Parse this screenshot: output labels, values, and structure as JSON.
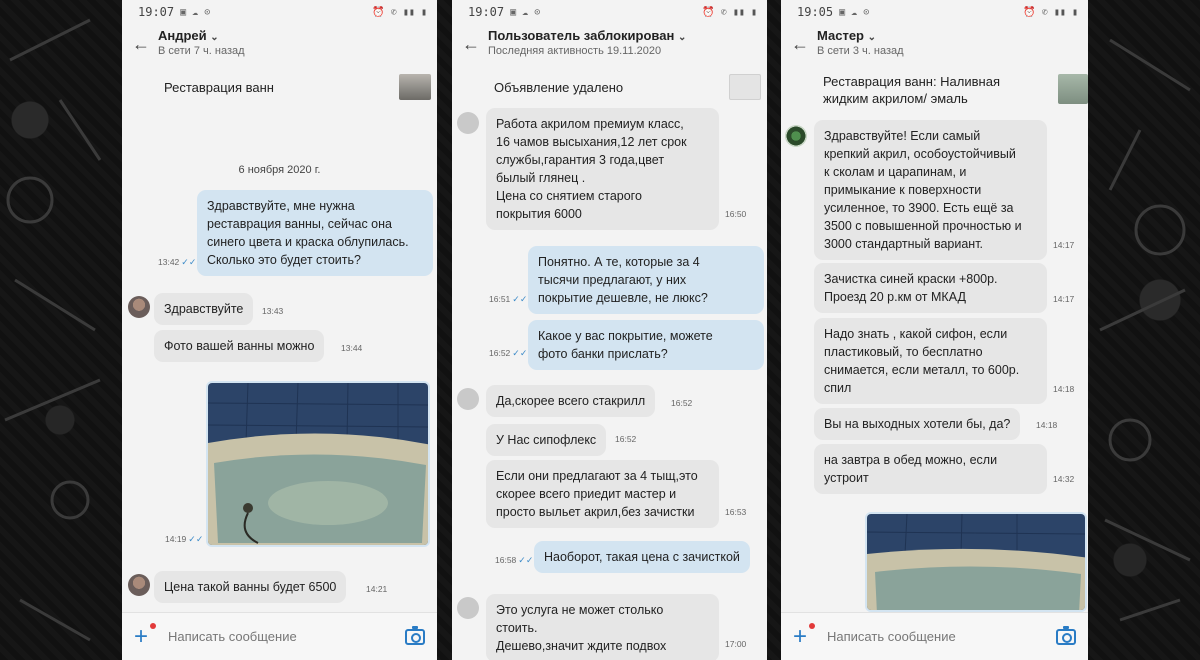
{
  "screens": [
    {
      "status_time": "19:07",
      "contact_name": "Андрей",
      "contact_status": "В сети 7 ч. назад",
      "ad_title": "Реставрация ванн",
      "date_separator": "6 ноября 2020 г.",
      "messages": [
        {
          "dir": "out",
          "text": "Здравствуйте,  мне нужна\nреставрация ванны, сейчас она\nсинего цвета и краска облупилась.\nСколько это будет стоить?",
          "time": "13:42"
        },
        {
          "dir": "in",
          "text": "Здравствуйте",
          "time": "13:43"
        },
        {
          "dir": "in",
          "text": "Фото вашей ванны можно",
          "time": "13:44"
        },
        {
          "dir": "out",
          "text": "",
          "time": "14:19",
          "photo": true
        },
        {
          "dir": "in",
          "text": "Цена такой ванны будет 6500",
          "time": "14:21"
        }
      ],
      "composer_placeholder": "Написать сообщение"
    },
    {
      "status_time": "19:07",
      "contact_name": "Пользователь заблокирован",
      "contact_status": "Последняя активность 19.11.2020",
      "ad_title": "Объявление удалено",
      "messages": [
        {
          "dir": "in",
          "text": "Работа акрилом премиум класс,\n16 чамов высыхания,12 лет срок\nслужбы,гарантия 3 года,цвет\nбылый глянец .\nЦена со снятием старого\nпокрытия 6000",
          "time": "16:50"
        },
        {
          "dir": "out",
          "text": "Понятно. А те, которые за 4\nтысячи предлагают, у них\nпокрытие дешевле, не люкс?",
          "time": "16:51"
        },
        {
          "dir": "out",
          "text": "Какое у вас покрытие, можете\nфото банки прислать?",
          "time": "16:52"
        },
        {
          "dir": "in",
          "text": "Да,скорее всего стакрилл",
          "time": "16:52"
        },
        {
          "dir": "in",
          "text": "У Нас сипофлекс",
          "time": "16:52"
        },
        {
          "dir": "in",
          "text": "Если они предлагают за 4 тыщ,это\nскорее всего приедит мастер и\nпросто выльет акрил,без зачистки",
          "time": "16:53"
        },
        {
          "dir": "out",
          "text": "Наоборот, такая цена с зачисткой",
          "time": "16:58"
        },
        {
          "dir": "in",
          "text": "Это услуга не может столько\nстоить.\nДешево,значит ждите подвох",
          "time": "17:00"
        }
      ]
    },
    {
      "status_time": "19:05",
      "contact_name": "Мастер",
      "contact_status": "В сети 3 ч. назад",
      "ad_title": "Реставрация ванн: Наливная\nжидким акрилом/ эмаль",
      "messages": [
        {
          "dir": "in",
          "text": "Здравствуйте!  Если самый\nкрепкий акрил, особоустойчивый\nк сколам и царапинам, и\nпримыкание к поверхности\nусиленное, то 3900. Есть ещё за\n3500 с повышенной прочностью и\n3000 стандартный вариант.",
          "time": "14:17"
        },
        {
          "dir": "in",
          "text": "Зачистка синей краски +800р.\nПроезд 20 р.км от МКАД",
          "time": "14:17"
        },
        {
          "dir": "in",
          "text": "Надо знать , какой сифон, если\nпластиковый, то бесплатно\nснимается, если металл, то 600р.\nспил",
          "time": "14:18"
        },
        {
          "dir": "in",
          "text": "Вы на выходных хотели бы, да?",
          "time": "14:18"
        },
        {
          "dir": "in",
          "text": "на завтра в обед можно, если\nустроит",
          "time": "14:32"
        },
        {
          "dir": "out",
          "text": "",
          "photo": true
        }
      ],
      "composer_placeholder": "Написать сообщение"
    }
  ],
  "colors": {
    "incoming_bubble": "#e6e6e6",
    "outgoing_bubble": "#d3e4f1",
    "accent": "#2a7cc5"
  },
  "icons": [
    "back-arrow-icon",
    "chevron-down-icon",
    "plus-icon",
    "camera-icon",
    "read-checkmarks-icon"
  ]
}
